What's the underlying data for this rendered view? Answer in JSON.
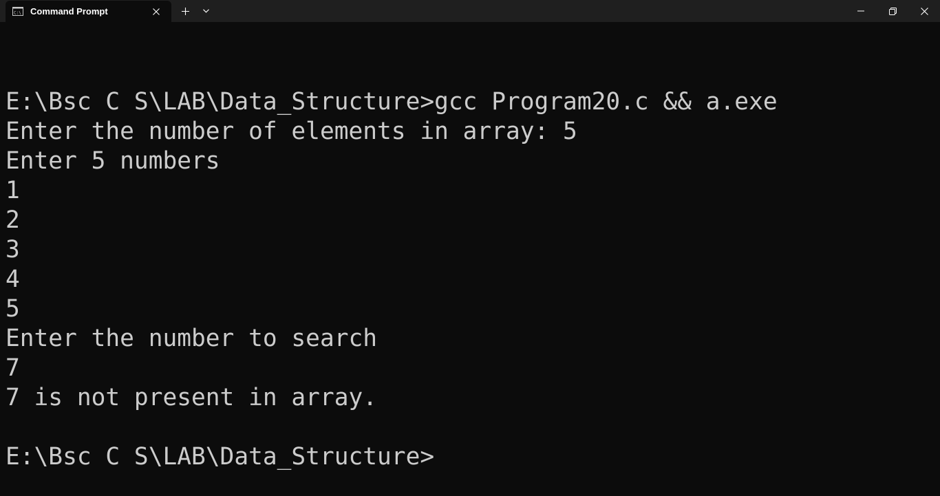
{
  "window": {
    "tab_title": "Command Prompt",
    "tab_icon": "cmd-icon",
    "close_tab_icon": "close-icon",
    "new_tab_icon": "plus-icon",
    "dropdown_icon": "chevron-down-icon",
    "minimize_icon": "minimize-icon",
    "maximize_icon": "restore-icon",
    "close_window_icon": "close-icon"
  },
  "colors": {
    "background": "#0c0c0c",
    "titlebar": "#1f1f1f",
    "text": "#cccccc"
  },
  "terminal": {
    "lines": [
      "",
      "E:\\Bsc C S\\LAB\\Data_Structure>gcc Program20.c && a.exe",
      "Enter the number of elements in array: 5",
      "Enter 5 numbers",
      "1",
      "2",
      "3",
      "4",
      "5",
      "Enter the number to search",
      "7",
      "7 is not present in array.",
      "",
      "E:\\Bsc C S\\LAB\\Data_Structure>"
    ]
  }
}
